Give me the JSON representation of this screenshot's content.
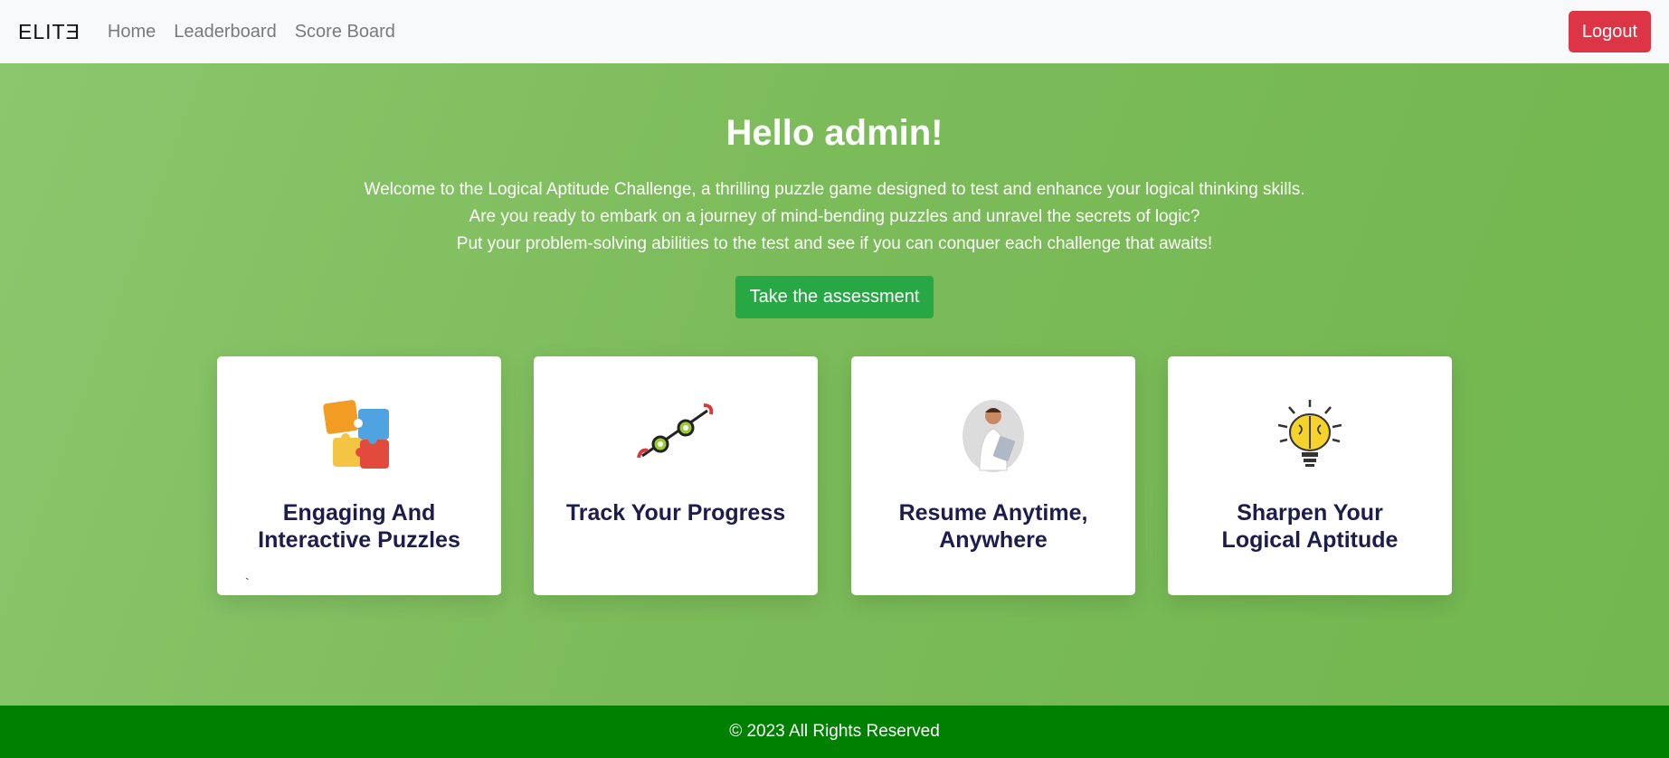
{
  "nav": {
    "brand": "ELITƎ",
    "links": [
      "Home",
      "Leaderboard",
      "Score Board"
    ],
    "logout_label": "Logout"
  },
  "hero": {
    "title": "Hello admin!",
    "lines": [
      "Welcome to the Logical Aptitude Challenge, a thrilling puzzle game designed to test and enhance your logical thinking skills.",
      "Are you ready to embark on a journey of mind-bending puzzles and unravel the secrets of logic?",
      "Put your problem-solving abilities to the test and see if you can conquer each challenge that awaits!"
    ],
    "cta_label": "Take the assessment"
  },
  "cards": [
    {
      "icon": "puzzle-pieces-icon",
      "line1": "Engaging And",
      "line2": "Interactive Puzzles",
      "extra": "`"
    },
    {
      "icon": "progress-chain-icon",
      "line1": "Track Your Progress",
      "line2": ""
    },
    {
      "icon": "person-thinking-icon",
      "line1": "Resume Anytime,",
      "line2": "Anywhere"
    },
    {
      "icon": "brain-lightbulb-icon",
      "line1": "Sharpen Your",
      "line2": "Logical Aptitude"
    }
  ],
  "footer": {
    "text": "© 2023 All Rights Reserved"
  },
  "colors": {
    "navbar_bg": "#f8f9fa",
    "hero_bg": "#7cbb5a",
    "logout_bg": "#dc3545",
    "cta_bg": "#28a745",
    "footer_bg": "#008000",
    "card_title": "#1d1d4d"
  }
}
